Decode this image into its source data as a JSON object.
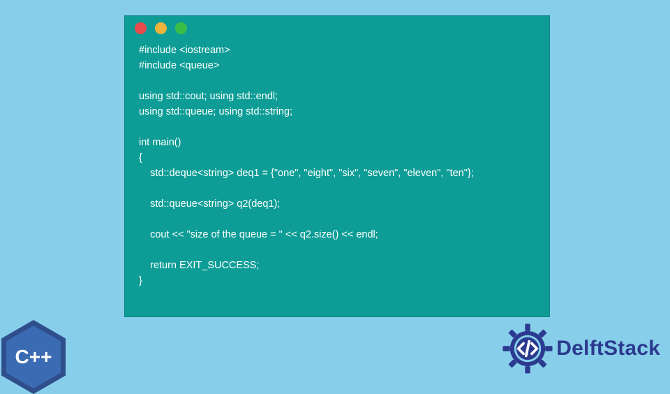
{
  "window": {
    "buttons": {
      "red": "#e94b4b",
      "yellow": "#edb43a",
      "green": "#3bbd47"
    }
  },
  "code": {
    "lines": [
      "#include <iostream>",
      "#include <queue>",
      "",
      "using std::cout; using std::endl;",
      "using std::queue; using std::string;",
      "",
      "int main()",
      "{",
      "    std::deque<string> deq1 = {\"one\", \"eight\", \"six\", \"seven\", \"eleven\", \"ten\"};",
      "",
      "    std::queue<string> q2(deq1);",
      "",
      "    cout << \"size of the queue = \" << q2.size() << endl;",
      "",
      "    return EXIT_SUCCESS;",
      "}"
    ]
  },
  "cpp_badge": {
    "label": "C++"
  },
  "brand": {
    "name": "DelftStack"
  }
}
